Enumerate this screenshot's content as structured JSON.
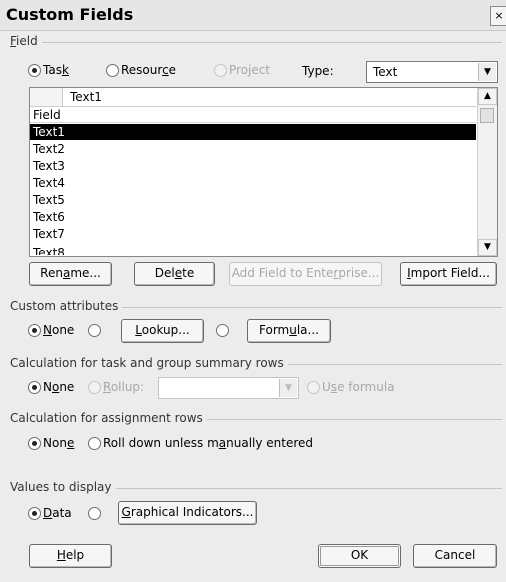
{
  "dialog": {
    "title": "Custom Fields",
    "close_glyph": "×"
  },
  "field_group": {
    "label": "Field"
  },
  "scope": {
    "task": "Task",
    "resource": "Resource",
    "project": "Project",
    "selected": "Task"
  },
  "type": {
    "label": "Type:",
    "value": "Text"
  },
  "field_list": {
    "edit_value": "Text1",
    "header": "Field",
    "items": [
      "Text1",
      "Text2",
      "Text3",
      "Text4",
      "Text5",
      "Text6",
      "Text7",
      "Text8"
    ],
    "selected": "Text1"
  },
  "buttons": {
    "rename": "Rename...",
    "delete": "Delete",
    "add_enterprise": "Add Field to Enterprise...",
    "import": "Import Field...",
    "lookup": "Lookup...",
    "formula": "Formula...",
    "graphical": "Graphical Indicators...",
    "help": "Help",
    "ok": "OK",
    "cancel": "Cancel"
  },
  "custom_attributes": {
    "label": "Custom attributes",
    "none": "None"
  },
  "task_summary": {
    "label": "Calculation for task and group summary rows",
    "none": "None",
    "rollup": "Rollup:",
    "rollup_value": "",
    "use_formula": "Use formula"
  },
  "assignment": {
    "label": "Calculation for assignment rows",
    "none": "None",
    "roll_down": "Roll down unless manually entered"
  },
  "values_display": {
    "label": "Values to display",
    "data": "Data"
  }
}
